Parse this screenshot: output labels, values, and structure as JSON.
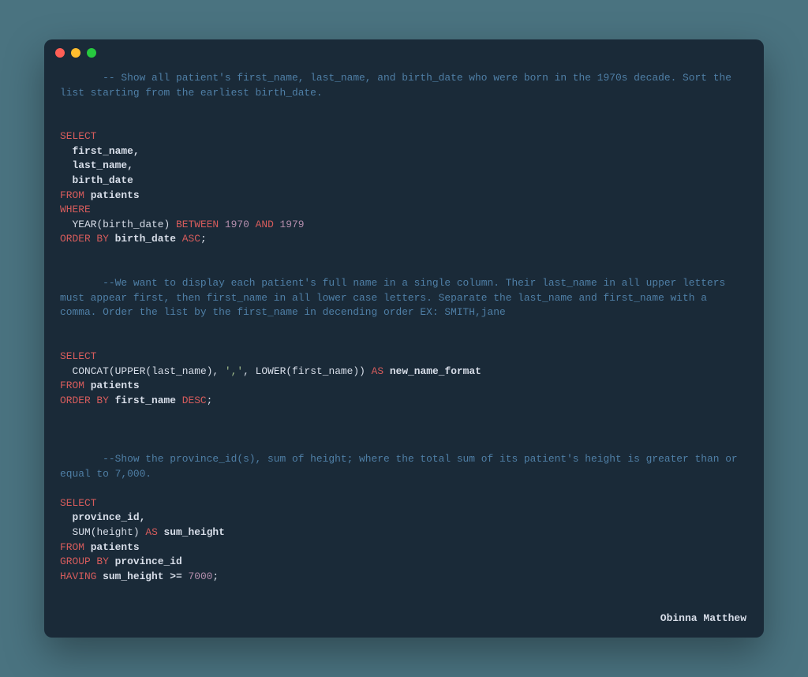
{
  "window": {
    "author": "Obinna Matthew"
  },
  "code": {
    "comment1": "       -- Show all patient's first_name, last_name, and birth_date who were born in the 1970s decade. Sort the list starting from the earliest birth_date.",
    "q1": {
      "select": "SELECT",
      "col1": "  first_name,",
      "col2": "  last_name,",
      "col3": "  birth_date",
      "from": "FROM",
      "table": " patients",
      "where": "WHERE",
      "yearFn": "  YEAR",
      "yearArg": "(birth_date) ",
      "between": "BETWEEN",
      "n1970": " 1970",
      "and": " AND",
      "n1979": " 1979",
      "orderby": "ORDER BY",
      "ordercol": " birth_date ",
      "asc": "ASC",
      "semi": ";"
    },
    "comment2": "       --We want to display each patient's full name in a single column. Their last_name in all upper letters must appear first, then first_name in all lower case letters. Separate the last_name and first_name with a comma. Order the list by the first_name in decending order EX: SMITH,jane",
    "q2": {
      "select": "SELECT",
      "concat": "  CONCAT",
      "open1": "(",
      "upper": "UPPER",
      "upperArg": "(last_name), ",
      "commaStr": "','",
      "sep": ", ",
      "lower": "LOWER",
      "lowerArg": "(first_name)) ",
      "as": "AS",
      "alias": " new_name_format",
      "from": "FROM",
      "table": " patients",
      "orderby": "ORDER BY",
      "ordercol": " first_name ",
      "desc": "DESC",
      "semi": ";"
    },
    "comment3": "       --Show the province_id(s), sum of height; where the total sum of its patient's height is greater than or equal to 7,000.",
    "q3": {
      "select": "SELECT",
      "col1": "  province_id,",
      "sumPrefix": "  SUM",
      "sumArg": "(height) ",
      "as": "AS",
      "alias": " sum_height",
      "from": "FROM",
      "table": " patients",
      "groupby": "GROUP BY",
      "groupcol": " province_id",
      "having": "HAVING",
      "havingExpr": " sum_height >= ",
      "n7000": "7000",
      "semi": ";"
    }
  }
}
